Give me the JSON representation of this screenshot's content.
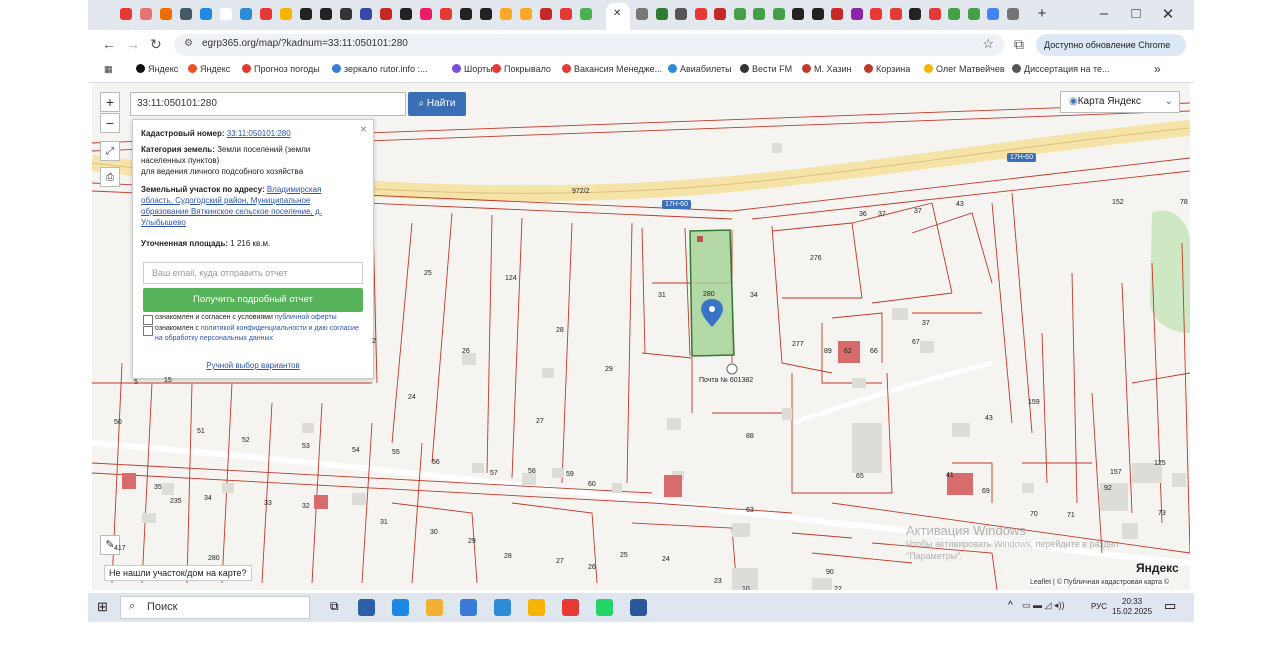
{
  "window": {
    "minimize": "–",
    "maximize": "□",
    "close": "✕",
    "new_tab": "+"
  },
  "address_bar": {
    "url": "egrp365.org/map/?kadnum=33:11:050101:280",
    "update_text": "Доступно обновление Chrome"
  },
  "bookmarks": [
    {
      "label": "Яндекс",
      "color": "#111111"
    },
    {
      "label": "Яндекс",
      "color": "#f04e23"
    },
    {
      "label": "Прогноз погоды",
      "color": "#e23b2e"
    },
    {
      "label": "зеркало rutor.info :...",
      "color": "#3a7bd5"
    },
    {
      "label": "Шорты",
      "color": "#7b4fd8"
    },
    {
      "label": "Покрывало",
      "color": "#e53935"
    },
    {
      "label": "Вакансия Менедже...",
      "color": "#e53935"
    },
    {
      "label": "Авиабилеты",
      "color": "#2c8cd8"
    },
    {
      "label": "Вести FM",
      "color": "#333333"
    },
    {
      "label": "М. Хазин",
      "color": "#c0392b"
    },
    {
      "label": "Корзина",
      "color": "#c0392b"
    },
    {
      "label": "Олег Матвейчев",
      "color": "#f4b400"
    },
    {
      "label": "Диссертация на те...",
      "color": "#555555"
    }
  ],
  "bookmarks_more": "»",
  "map": {
    "search_value": "33:11:050101:280",
    "find_button": "Найти",
    "layer_select": "Карта Яндекс",
    "zoom_in": "+",
    "zoom_out": "−",
    "popup": {
      "cadastral_label": "Кадастровый номер:",
      "cadastral_value": "33:11:050101:280",
      "category_label": "Категория земель:",
      "category_value": "Земли поселений (земли населенных пунктов)",
      "usage": "для ведения личного подсобного хозяйства",
      "address_label": "Земельный участок по адресу:",
      "address_value": "Владимирская область, Судогодский район, Муниципальное образование Вяткинское сельское поселение, д. Улыбышево",
      "area_label": "Уточненная площадь:",
      "area_value": "1 216 кв.м.",
      "email_placeholder": "Ваш email, куда отправить отчет",
      "report_button": "Получить подробный отчет",
      "consent1_prefix": "ознакомлен и согласен с условиями",
      "consent1_link": "публичной оферты",
      "consent2_prefix": "ознакомлен с",
      "consent2_link": "политикой конфиденциальности и даю согласие на обработку персональных данных",
      "manual_link": "Ручной выбор вариантов"
    },
    "road_labels": [
      "17Н-60",
      "17Н-60",
      "17Н-60"
    ],
    "road_number": "972/2",
    "post_office": "Почта № 601382",
    "plot_numbers": [
      "25",
      "124",
      "31",
      "280",
      "34",
      "276",
      "36",
      "37",
      "37",
      "43",
      "28",
      "26",
      "29",
      "277",
      "89",
      "62",
      "66",
      "67",
      "37",
      "24",
      "27",
      "88",
      "43",
      "159",
      "50",
      "51",
      "52",
      "53",
      "54",
      "55",
      "56",
      "57",
      "58",
      "59",
      "60",
      "63",
      "65",
      "41",
      "69",
      "70",
      "71",
      "92",
      "157",
      "125",
      "73",
      "35",
      "34",
      "33",
      "32",
      "31",
      "30",
      "29",
      "28",
      "27",
      "26",
      "25",
      "24",
      "23",
      "10",
      "90",
      "22",
      "2",
      "5",
      "15",
      "417",
      "280",
      "235",
      "152",
      "78"
    ],
    "not_found": "Не нашли участок/дом на карте?",
    "watermark_title": "Активация Windows",
    "watermark_text": "Чтобы активировать Windows, перейдите в раздел \"Параметры\".",
    "yandex_logo": "Яндекс",
    "attribution": "Leaflet | © Публичная кадастровая карта ©"
  },
  "taskbar": {
    "search": "Поиск",
    "lang": "РУС",
    "time": "20:33",
    "date": "15.02.2025",
    "app_colors": [
      "#2d5fa8",
      "#1e88e5",
      "#f2b134",
      "#3a7bd5",
      "#2c8cd8",
      "#f4b400",
      "#e53935",
      "#25d366",
      "#2b579a"
    ]
  }
}
